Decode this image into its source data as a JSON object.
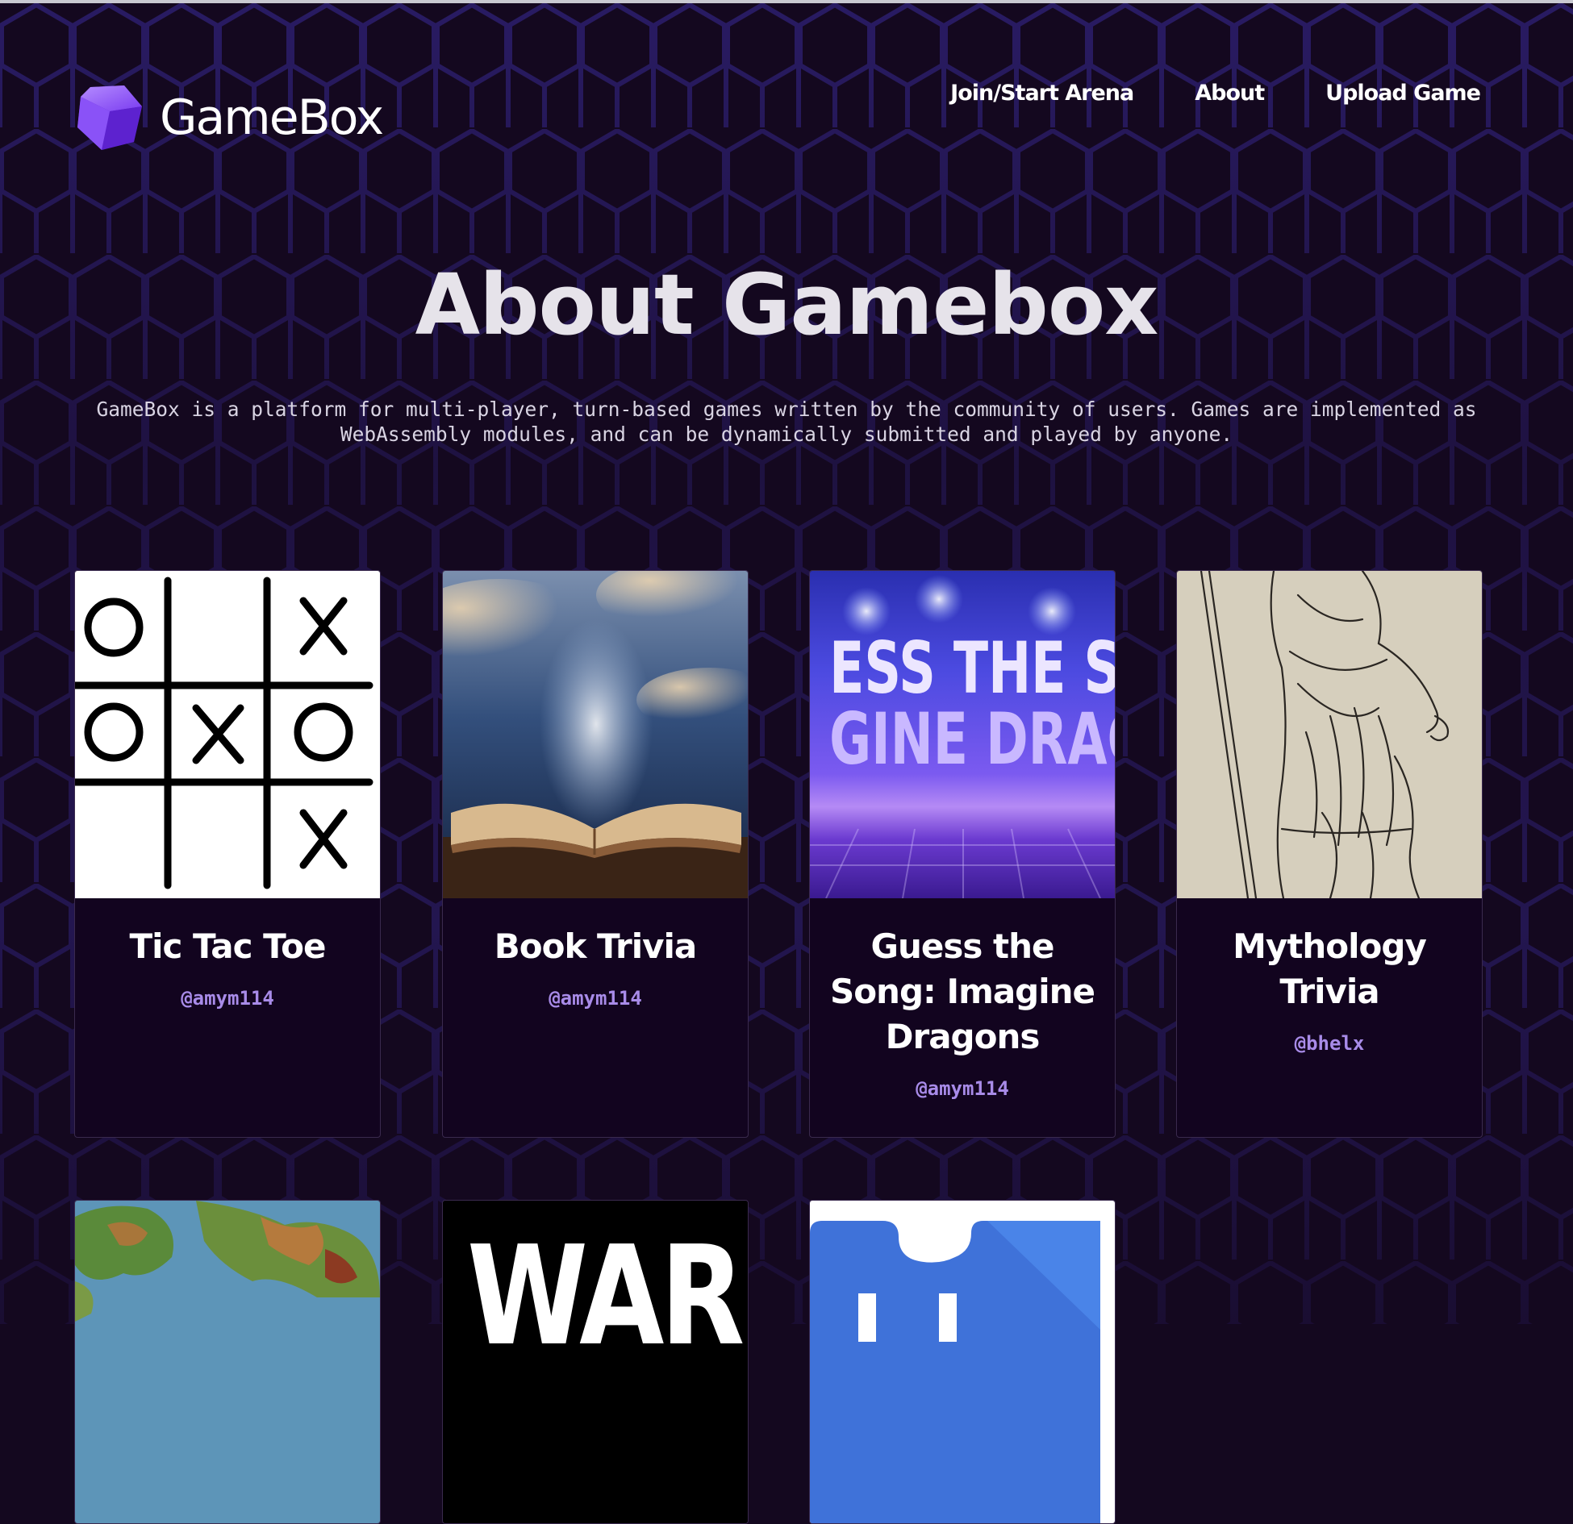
{
  "header": {
    "brand": "GameBox",
    "nav": [
      {
        "label": "Join/Start Arena"
      },
      {
        "label": "About"
      },
      {
        "label": "Upload Game"
      }
    ]
  },
  "hero": {
    "title": "About Gamebox",
    "description": "GameBox is a platform for multi-player, turn-based games written by the community of users. Games are implemented as WebAssembly modules, and can be dynamically submitted and played by anyone."
  },
  "games": [
    {
      "title": "Tic Tac Toe",
      "author": "@amym114"
    },
    {
      "title": "Book Trivia",
      "author": "@amym114"
    },
    {
      "title": "Guess the Song: Imagine Dragons",
      "author": "@amym114",
      "image_text": [
        "ESS THE SO",
        "GINE DRAGO"
      ]
    },
    {
      "title": "Mythology Trivia",
      "author": "@bhelx"
    },
    {
      "title": "",
      "author": ""
    },
    {
      "title": "",
      "author": "",
      "image_text": "WAR"
    },
    {
      "title": "",
      "author": ""
    }
  ],
  "colors": {
    "background": "#14081f",
    "hex_glow": "#3a2aa0",
    "accent": "#a88be8",
    "card_bg": "#12041f"
  }
}
